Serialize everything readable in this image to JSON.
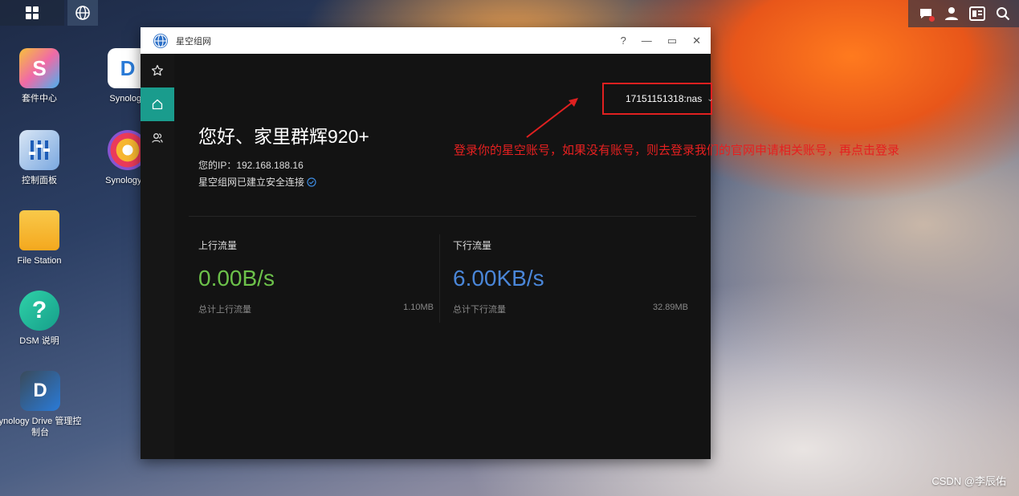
{
  "desktop": {
    "icons": [
      {
        "label": "套件中心"
      },
      {
        "label": "Synology"
      },
      {
        "label": "控制面板"
      },
      {
        "label": "Synology P"
      },
      {
        "label": "File Station"
      },
      {
        "label": "DSM 说明"
      },
      {
        "label": "ynology Drive 管理控制台"
      }
    ]
  },
  "window": {
    "title": "星空组网",
    "controls": {
      "help": "?",
      "minimize": "—",
      "maximize": "▭",
      "close": "✕"
    },
    "account": {
      "name": "17151151318:nas",
      "chevron": "⌄"
    },
    "greeting": "您好、家里群辉920+",
    "ip_line": "您的IP：192.168.188.16",
    "secure_line": "星空组网已建立安全连接",
    "upload": {
      "label": "上行流量",
      "value": "0.00B/s",
      "total_label": "总计上行流量",
      "total_value": "1.10MB"
    },
    "download": {
      "label": "下行流量",
      "value": "6.00KB/s",
      "total_label": "总计下行流量",
      "total_value": "32.89MB"
    }
  },
  "annotation": "登录你的星空账号，如果没有账号，则去登录我们的官网申请相关账号，再点击登录",
  "watermark": "CSDN @李辰佑",
  "colors": {
    "accent": "#1a9c8d",
    "upload": "#6cc14a",
    "download": "#4a86d8",
    "highlight": "#e02020"
  }
}
